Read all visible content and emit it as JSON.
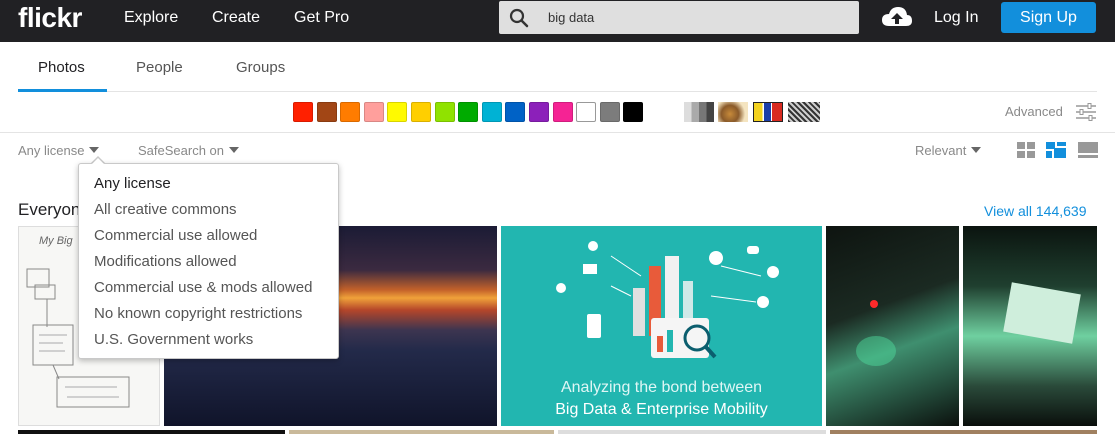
{
  "header": {
    "logo": "flickr",
    "nav": [
      "Explore",
      "Create",
      "Get Pro"
    ],
    "search_value": "big data",
    "login": "Log In",
    "signup": "Sign Up"
  },
  "tabs": [
    {
      "label": "Photos",
      "active": true
    },
    {
      "label": "People",
      "active": false
    },
    {
      "label": "Groups",
      "active": false
    }
  ],
  "color_swatches": [
    "#ff2000",
    "#a24615",
    "#ff7c00",
    "#ff9f9c",
    "#fffa00",
    "#ffcf00",
    "#90e200",
    "#00ab00",
    "#00b2d4",
    "#0062c6",
    "#8c20ba",
    "#f52394",
    "#ffffff",
    "#7c7c7c",
    "#000000"
  ],
  "style_filters": [
    "black-and-white",
    "shallow-depth-of-field",
    "minimalist",
    "patterns"
  ],
  "advanced_label": "Advanced",
  "filters": {
    "license": "Any license",
    "safesearch": "SafeSearch on",
    "sort": "Relevant"
  },
  "results": {
    "heading": "Everyone's photos",
    "view_all": "View all 144,639"
  },
  "license_menu": {
    "items": [
      "Any license",
      "All creative commons",
      "Commercial use allowed",
      "Modifications allowed",
      "Commercial use & mods allowed",
      "No known copyright restrictions",
      "U.S. Government works"
    ]
  },
  "photos": {
    "sketch_text": "My Big",
    "infographic_line1": "Analyzing the bond between",
    "infographic_line2": "Big Data & Enterprise Mobility"
  }
}
